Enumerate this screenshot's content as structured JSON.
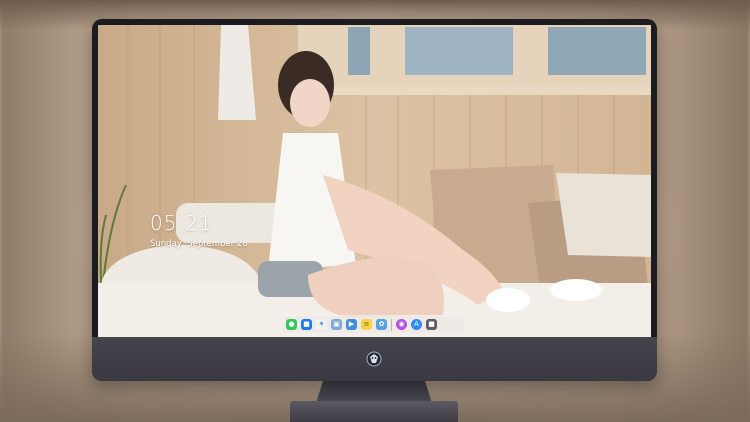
{
  "lock_screen": {
    "time": "05:21",
    "date": "Sunday, September 28"
  },
  "dock": {
    "apps": [
      {
        "name": "messages-icon",
        "color": "#34c759"
      },
      {
        "name": "finder-icon",
        "color": "#1e7cf2"
      },
      {
        "name": "safari-icon",
        "color": "#f2f2f2"
      },
      {
        "name": "preview-icon",
        "color": "#7fa8d8"
      },
      {
        "name": "clapper-icon",
        "color": "#3d8fd9"
      },
      {
        "name": "notes-icon",
        "color": "#f7d24a"
      },
      {
        "name": "photos-icon",
        "color": "#5aa0e0"
      },
      {
        "name": "podcasts-icon",
        "color": "#b04fe0"
      },
      {
        "name": "app-store-icon",
        "color": "#2f8cf0"
      },
      {
        "name": "camera-icon",
        "color": "#5c5c62"
      }
    ]
  },
  "colors": {
    "bezel": "#1c1b1f",
    "chin": "#3f3e47",
    "wallpaper_wood": "#d6bc9c"
  }
}
